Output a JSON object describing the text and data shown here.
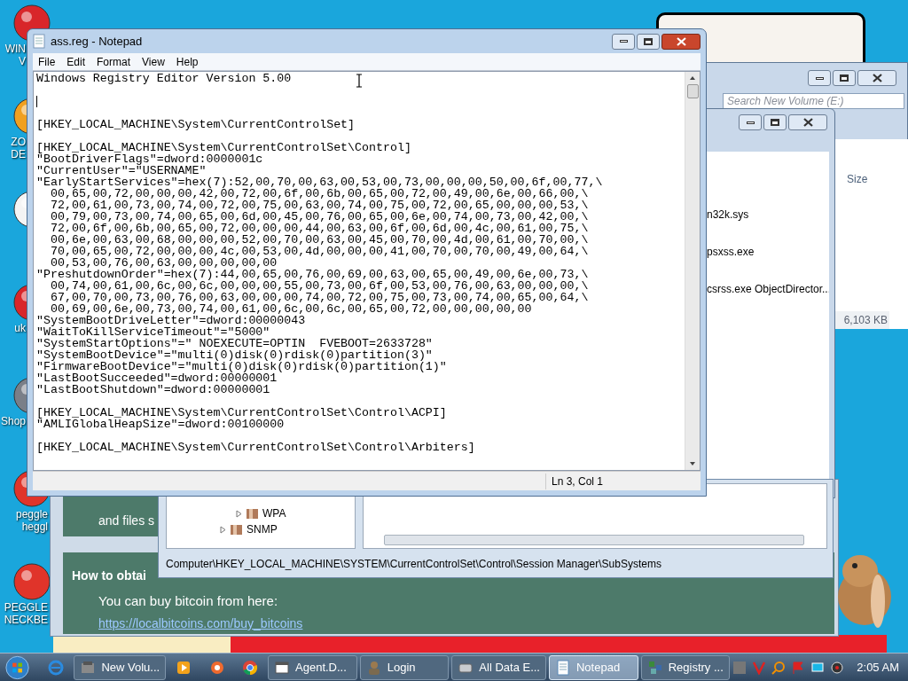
{
  "desktop_icons": [
    {
      "label": "WIN\nV",
      "kind": "ball"
    },
    {
      "label": "ZO\nDE",
      "kind": "fox"
    },
    {
      "kind": "flower"
    },
    {
      "label": "uk",
      "kind": "ball"
    },
    {
      "label": "Shop",
      "kind": "sphere"
    },
    {
      "label": "peggle\nheggl",
      "kind": "peggle"
    },
    {
      "label": "PEGGLE\nNECKBE",
      "kind": "peggle"
    }
  ],
  "web_page": {
    "text_1": "and files s",
    "heading": "How to obtai",
    "body": "You can buy bitcoin from here:",
    "link": "https://localbitcoins.com/buy_bitcoins"
  },
  "object_window": {
    "items": [
      "n32k.sys",
      "psxss.exe",
      "csrss.exe ObjectDirector..."
    ]
  },
  "explorer": {
    "search_placeholder": "Search New Volume (E:)",
    "column": "Size",
    "value": "6,103 KB"
  },
  "registry_editor": {
    "tree": [
      {
        "label": "WPA"
      },
      {
        "label": "SNMP"
      }
    ],
    "status": "Computer\\HKEY_LOCAL_MACHINE\\SYSTEM\\CurrentControlSet\\Control\\Session Manager\\SubSystems"
  },
  "notepad": {
    "title": "ass.reg - Notepad",
    "menu": [
      "File",
      "Edit",
      "Format",
      "View",
      "Help"
    ],
    "paragraphs": [
      {
        "kind": "text",
        "lines": [
          "Windows Registry Editor Version 5.00"
        ]
      },
      {
        "kind": "caret"
      },
      {
        "kind": "text",
        "lines": [
          "[HKEY_LOCAL_MACHINE\\System\\CurrentControlSet]"
        ]
      },
      {
        "kind": "text",
        "lines": [
          "[HKEY_LOCAL_MACHINE\\System\\CurrentControlSet\\Control]",
          "\"BootDriverFlags\"=dword:0000001c",
          "\"CurrentUser\"=\"USERNAME\"",
          "\"EarlyStartServices\"=hex(7):52,00,70,00,63,00,53,00,73,00,00,00,50,00,6f,00,77,\\",
          "  00,65,00,72,00,00,00,42,00,72,00,6f,00,6b,00,65,00,72,00,49,00,6e,00,66,00,\\",
          "  72,00,61,00,73,00,74,00,72,00,75,00,63,00,74,00,75,00,72,00,65,00,00,00,53,\\",
          "  00,79,00,73,00,74,00,65,00,6d,00,45,00,76,00,65,00,6e,00,74,00,73,00,42,00,\\",
          "  72,00,6f,00,6b,00,65,00,72,00,00,00,44,00,63,00,6f,00,6d,00,4c,00,61,00,75,\\",
          "  00,6e,00,63,00,68,00,00,00,52,00,70,00,63,00,45,00,70,00,4d,00,61,00,70,00,\\",
          "  70,00,65,00,72,00,00,00,4c,00,53,00,4d,00,00,00,41,00,70,00,70,00,49,00,64,\\",
          "  00,53,00,76,00,63,00,00,00,00,00",
          "\"PreshutdownOrder\"=hex(7):44,00,65,00,76,00,69,00,63,00,65,00,49,00,6e,00,73,\\",
          "  00,74,00,61,00,6c,00,6c,00,00,00,55,00,73,00,6f,00,53,00,76,00,63,00,00,00,\\",
          "  67,00,70,00,73,00,76,00,63,00,00,00,74,00,72,00,75,00,73,00,74,00,65,00,64,\\",
          "  00,69,00,6e,00,73,00,74,00,61,00,6c,00,6c,00,65,00,72,00,00,00,00,00",
          "\"SystemBootDriveLetter\"=dword:00000043",
          "\"WaitToKillServiceTimeout\"=\"5000\"",
          "\"SystemStartOptions\"=\" NOEXECUTE=OPTIN  FVEBOOT=2633728\"",
          "\"SystemBootDevice\"=\"multi(0)disk(0)rdisk(0)partition(3)\"",
          "\"FirmwareBootDevice\"=\"multi(0)disk(0)rdisk(0)partition(1)\"",
          "\"LastBootSucceeded\"=dword:00000001",
          "\"LastBootShutdown\"=dword:00000001"
        ]
      },
      {
        "kind": "text",
        "lines": [
          "[HKEY_LOCAL_MACHINE\\System\\CurrentControlSet\\Control\\ACPI]",
          "\"AMLIGlobalHeapSize\"=dword:00100000"
        ]
      },
      {
        "kind": "text",
        "lines": [
          "[HKEY_LOCAL_MACHINE\\System\\CurrentControlSet\\Control\\Arbiters]"
        ]
      }
    ],
    "status": "Ln 3, Col 1"
  },
  "taskbar": {
    "items": [
      {
        "kind": "pin"
      },
      {
        "kind": "task",
        "label": "New Volu...",
        "selected": false
      },
      {
        "kind": "pin"
      },
      {
        "kind": "pin"
      },
      {
        "kind": "pin"
      },
      {
        "kind": "task",
        "label": "Agent.D...",
        "selected": false
      },
      {
        "kind": "task",
        "label": "Login",
        "selected": false
      },
      {
        "kind": "task",
        "label": "All Data E...",
        "selected": false
      },
      {
        "kind": "task",
        "label": "Notepad",
        "selected": true
      },
      {
        "kind": "task",
        "label": "Registry ...",
        "selected": false
      }
    ],
    "clock": "2:05 AM"
  }
}
